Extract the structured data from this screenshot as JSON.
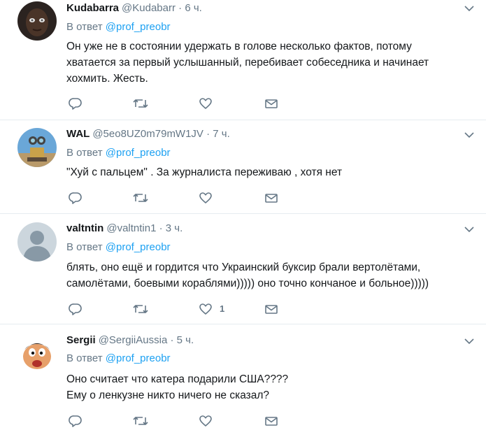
{
  "reply_prefix": "В ответ",
  "tweets": [
    {
      "name": "Kudabarra",
      "handle": "@Kudabarr",
      "time": "6 ч.",
      "reply_to": "@prof_preobr",
      "text_lines": [
        "Он уже не в состоянии удержать в голове несколько фактов, потому",
        "хватается за первый услышанный, перебивает собеседника и начинает",
        "хохмить. Жесть."
      ],
      "like_count": ""
    },
    {
      "name": "WAL",
      "handle": "@5eo8UZ0m79mW1JV",
      "time": "7 ч.",
      "reply_to": "@prof_preobr",
      "text_lines": [
        "\"Хуй с пальцем\" . За журналиста переживаю , хотя нет"
      ],
      "like_count": ""
    },
    {
      "name": "valtntin",
      "handle": "@valtntin1",
      "time": "3 ч.",
      "reply_to": "@prof_preobr",
      "text_lines": [
        "блять, оно ещё и гордится что Украинский буксир брали вертолётами,",
        "самолётами, боевыми кораблями))))) оно точно кончаное и больное)))))"
      ],
      "like_count": "1"
    },
    {
      "name": "Sergii",
      "handle": "@SergiiAussia",
      "time": "5 ч.",
      "reply_to": "@prof_preobr",
      "text_lines": [
        "Оно считает что катера подарили США????",
        "Ему о ленкузне никто ничего не сказал?"
      ],
      "like_count": ""
    }
  ],
  "separator": "·",
  "colors": {
    "link": "#1da1f2",
    "secondary": "#657786",
    "text": "#14171a",
    "divider": "#e6ecf0"
  },
  "icons": [
    "chevron-down-icon",
    "reply-icon",
    "retweet-icon",
    "like-icon",
    "direct-message-icon"
  ]
}
